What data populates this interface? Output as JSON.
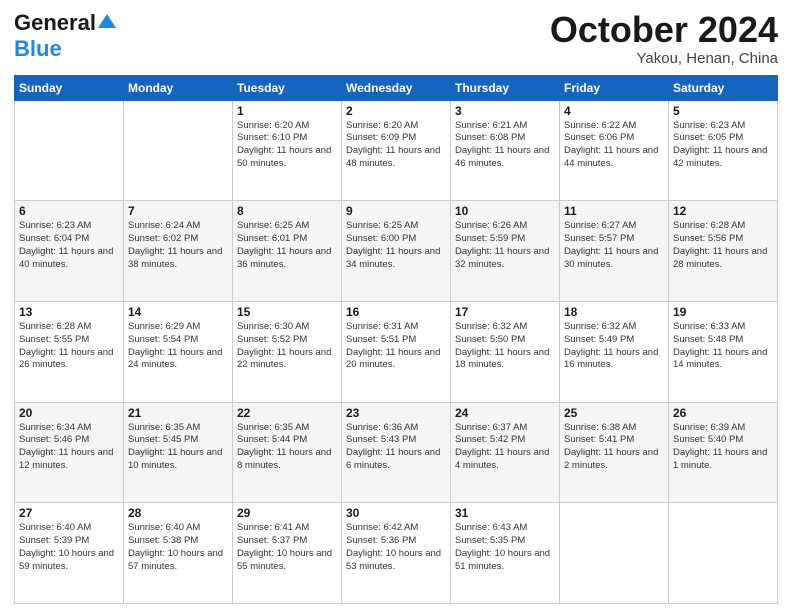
{
  "header": {
    "logo_line1": "General",
    "logo_line2": "Blue",
    "month": "October 2024",
    "location": "Yakou, Henan, China"
  },
  "weekdays": [
    "Sunday",
    "Monday",
    "Tuesday",
    "Wednesday",
    "Thursday",
    "Friday",
    "Saturday"
  ],
  "weeks": [
    [
      {
        "day": "",
        "info": ""
      },
      {
        "day": "",
        "info": ""
      },
      {
        "day": "1",
        "info": "Sunrise: 6:20 AM\nSunset: 6:10 PM\nDaylight: 11 hours and 50 minutes."
      },
      {
        "day": "2",
        "info": "Sunrise: 6:20 AM\nSunset: 6:09 PM\nDaylight: 11 hours and 48 minutes."
      },
      {
        "day": "3",
        "info": "Sunrise: 6:21 AM\nSunset: 6:08 PM\nDaylight: 11 hours and 46 minutes."
      },
      {
        "day": "4",
        "info": "Sunrise: 6:22 AM\nSunset: 6:06 PM\nDaylight: 11 hours and 44 minutes."
      },
      {
        "day": "5",
        "info": "Sunrise: 6:23 AM\nSunset: 6:05 PM\nDaylight: 11 hours and 42 minutes."
      }
    ],
    [
      {
        "day": "6",
        "info": "Sunrise: 6:23 AM\nSunset: 6:04 PM\nDaylight: 11 hours and 40 minutes."
      },
      {
        "day": "7",
        "info": "Sunrise: 6:24 AM\nSunset: 6:02 PM\nDaylight: 11 hours and 38 minutes."
      },
      {
        "day": "8",
        "info": "Sunrise: 6:25 AM\nSunset: 6:01 PM\nDaylight: 11 hours and 36 minutes."
      },
      {
        "day": "9",
        "info": "Sunrise: 6:25 AM\nSunset: 6:00 PM\nDaylight: 11 hours and 34 minutes."
      },
      {
        "day": "10",
        "info": "Sunrise: 6:26 AM\nSunset: 5:59 PM\nDaylight: 11 hours and 32 minutes."
      },
      {
        "day": "11",
        "info": "Sunrise: 6:27 AM\nSunset: 5:57 PM\nDaylight: 11 hours and 30 minutes."
      },
      {
        "day": "12",
        "info": "Sunrise: 6:28 AM\nSunset: 5:56 PM\nDaylight: 11 hours and 28 minutes."
      }
    ],
    [
      {
        "day": "13",
        "info": "Sunrise: 6:28 AM\nSunset: 5:55 PM\nDaylight: 11 hours and 26 minutes."
      },
      {
        "day": "14",
        "info": "Sunrise: 6:29 AM\nSunset: 5:54 PM\nDaylight: 11 hours and 24 minutes."
      },
      {
        "day": "15",
        "info": "Sunrise: 6:30 AM\nSunset: 5:52 PM\nDaylight: 11 hours and 22 minutes."
      },
      {
        "day": "16",
        "info": "Sunrise: 6:31 AM\nSunset: 5:51 PM\nDaylight: 11 hours and 20 minutes."
      },
      {
        "day": "17",
        "info": "Sunrise: 6:32 AM\nSunset: 5:50 PM\nDaylight: 11 hours and 18 minutes."
      },
      {
        "day": "18",
        "info": "Sunrise: 6:32 AM\nSunset: 5:49 PM\nDaylight: 11 hours and 16 minutes."
      },
      {
        "day": "19",
        "info": "Sunrise: 6:33 AM\nSunset: 5:48 PM\nDaylight: 11 hours and 14 minutes."
      }
    ],
    [
      {
        "day": "20",
        "info": "Sunrise: 6:34 AM\nSunset: 5:46 PM\nDaylight: 11 hours and 12 minutes."
      },
      {
        "day": "21",
        "info": "Sunrise: 6:35 AM\nSunset: 5:45 PM\nDaylight: 11 hours and 10 minutes."
      },
      {
        "day": "22",
        "info": "Sunrise: 6:35 AM\nSunset: 5:44 PM\nDaylight: 11 hours and 8 minutes."
      },
      {
        "day": "23",
        "info": "Sunrise: 6:36 AM\nSunset: 5:43 PM\nDaylight: 11 hours and 6 minutes."
      },
      {
        "day": "24",
        "info": "Sunrise: 6:37 AM\nSunset: 5:42 PM\nDaylight: 11 hours and 4 minutes."
      },
      {
        "day": "25",
        "info": "Sunrise: 6:38 AM\nSunset: 5:41 PM\nDaylight: 11 hours and 2 minutes."
      },
      {
        "day": "26",
        "info": "Sunrise: 6:39 AM\nSunset: 5:40 PM\nDaylight: 11 hours and 1 minute."
      }
    ],
    [
      {
        "day": "27",
        "info": "Sunrise: 6:40 AM\nSunset: 5:39 PM\nDaylight: 10 hours and 59 minutes."
      },
      {
        "day": "28",
        "info": "Sunrise: 6:40 AM\nSunset: 5:38 PM\nDaylight: 10 hours and 57 minutes."
      },
      {
        "day": "29",
        "info": "Sunrise: 6:41 AM\nSunset: 5:37 PM\nDaylight: 10 hours and 55 minutes."
      },
      {
        "day": "30",
        "info": "Sunrise: 6:42 AM\nSunset: 5:36 PM\nDaylight: 10 hours and 53 minutes."
      },
      {
        "day": "31",
        "info": "Sunrise: 6:43 AM\nSunset: 5:35 PM\nDaylight: 10 hours and 51 minutes."
      },
      {
        "day": "",
        "info": ""
      },
      {
        "day": "",
        "info": ""
      }
    ]
  ]
}
